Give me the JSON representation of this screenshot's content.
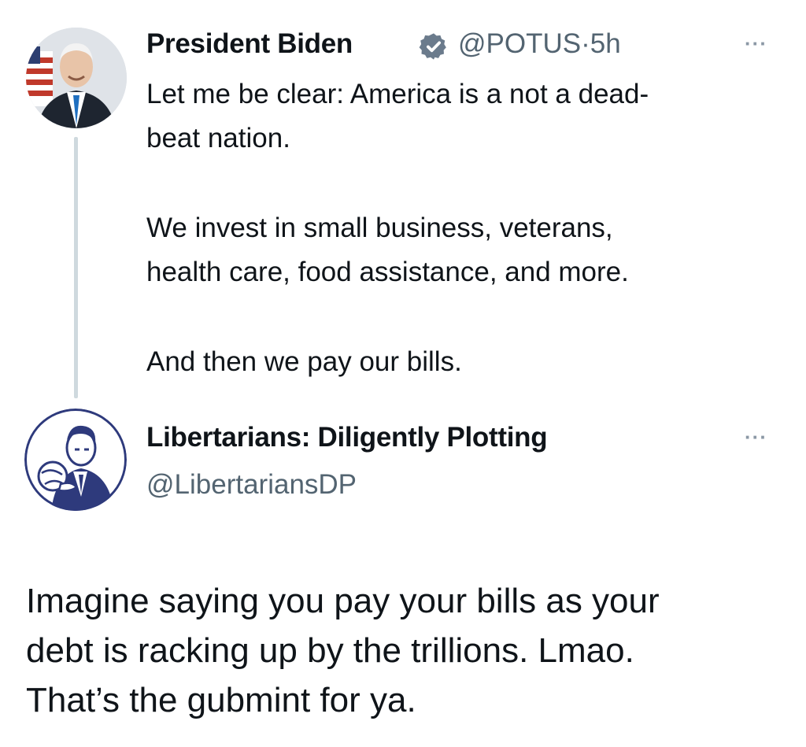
{
  "original_tweet": {
    "author_name": "President Biden",
    "handle": "@POTUS",
    "separator": "·",
    "time": "5h",
    "more_label": "···",
    "paragraph_1": "Let me be clear: America is a not a dead-\nbeat nation.",
    "paragraph_2": "We invest in small business, veterans,\nhealth care, food assistance, and more.",
    "paragraph_3": "And then we pay our bills.",
    "verified_badge_color": "#1d9bf0",
    "avatar_icon": "president-portrait"
  },
  "reply": {
    "author_name": "Libertarians: Diligently Plotting",
    "handle": "@LibertariansDP",
    "more_label": "···",
    "text": "Imagine saying you pay your bills as your\ndebt is racking up by the trillions. Lmao.\nThat’s the gubmint for ya.",
    "avatar_icon": "retro-man-illustration",
    "avatar_color": "#2e3a7c"
  },
  "colors": {
    "text": "#0f1419",
    "secondary": "#536471",
    "thread_line": "#cfd9de"
  }
}
